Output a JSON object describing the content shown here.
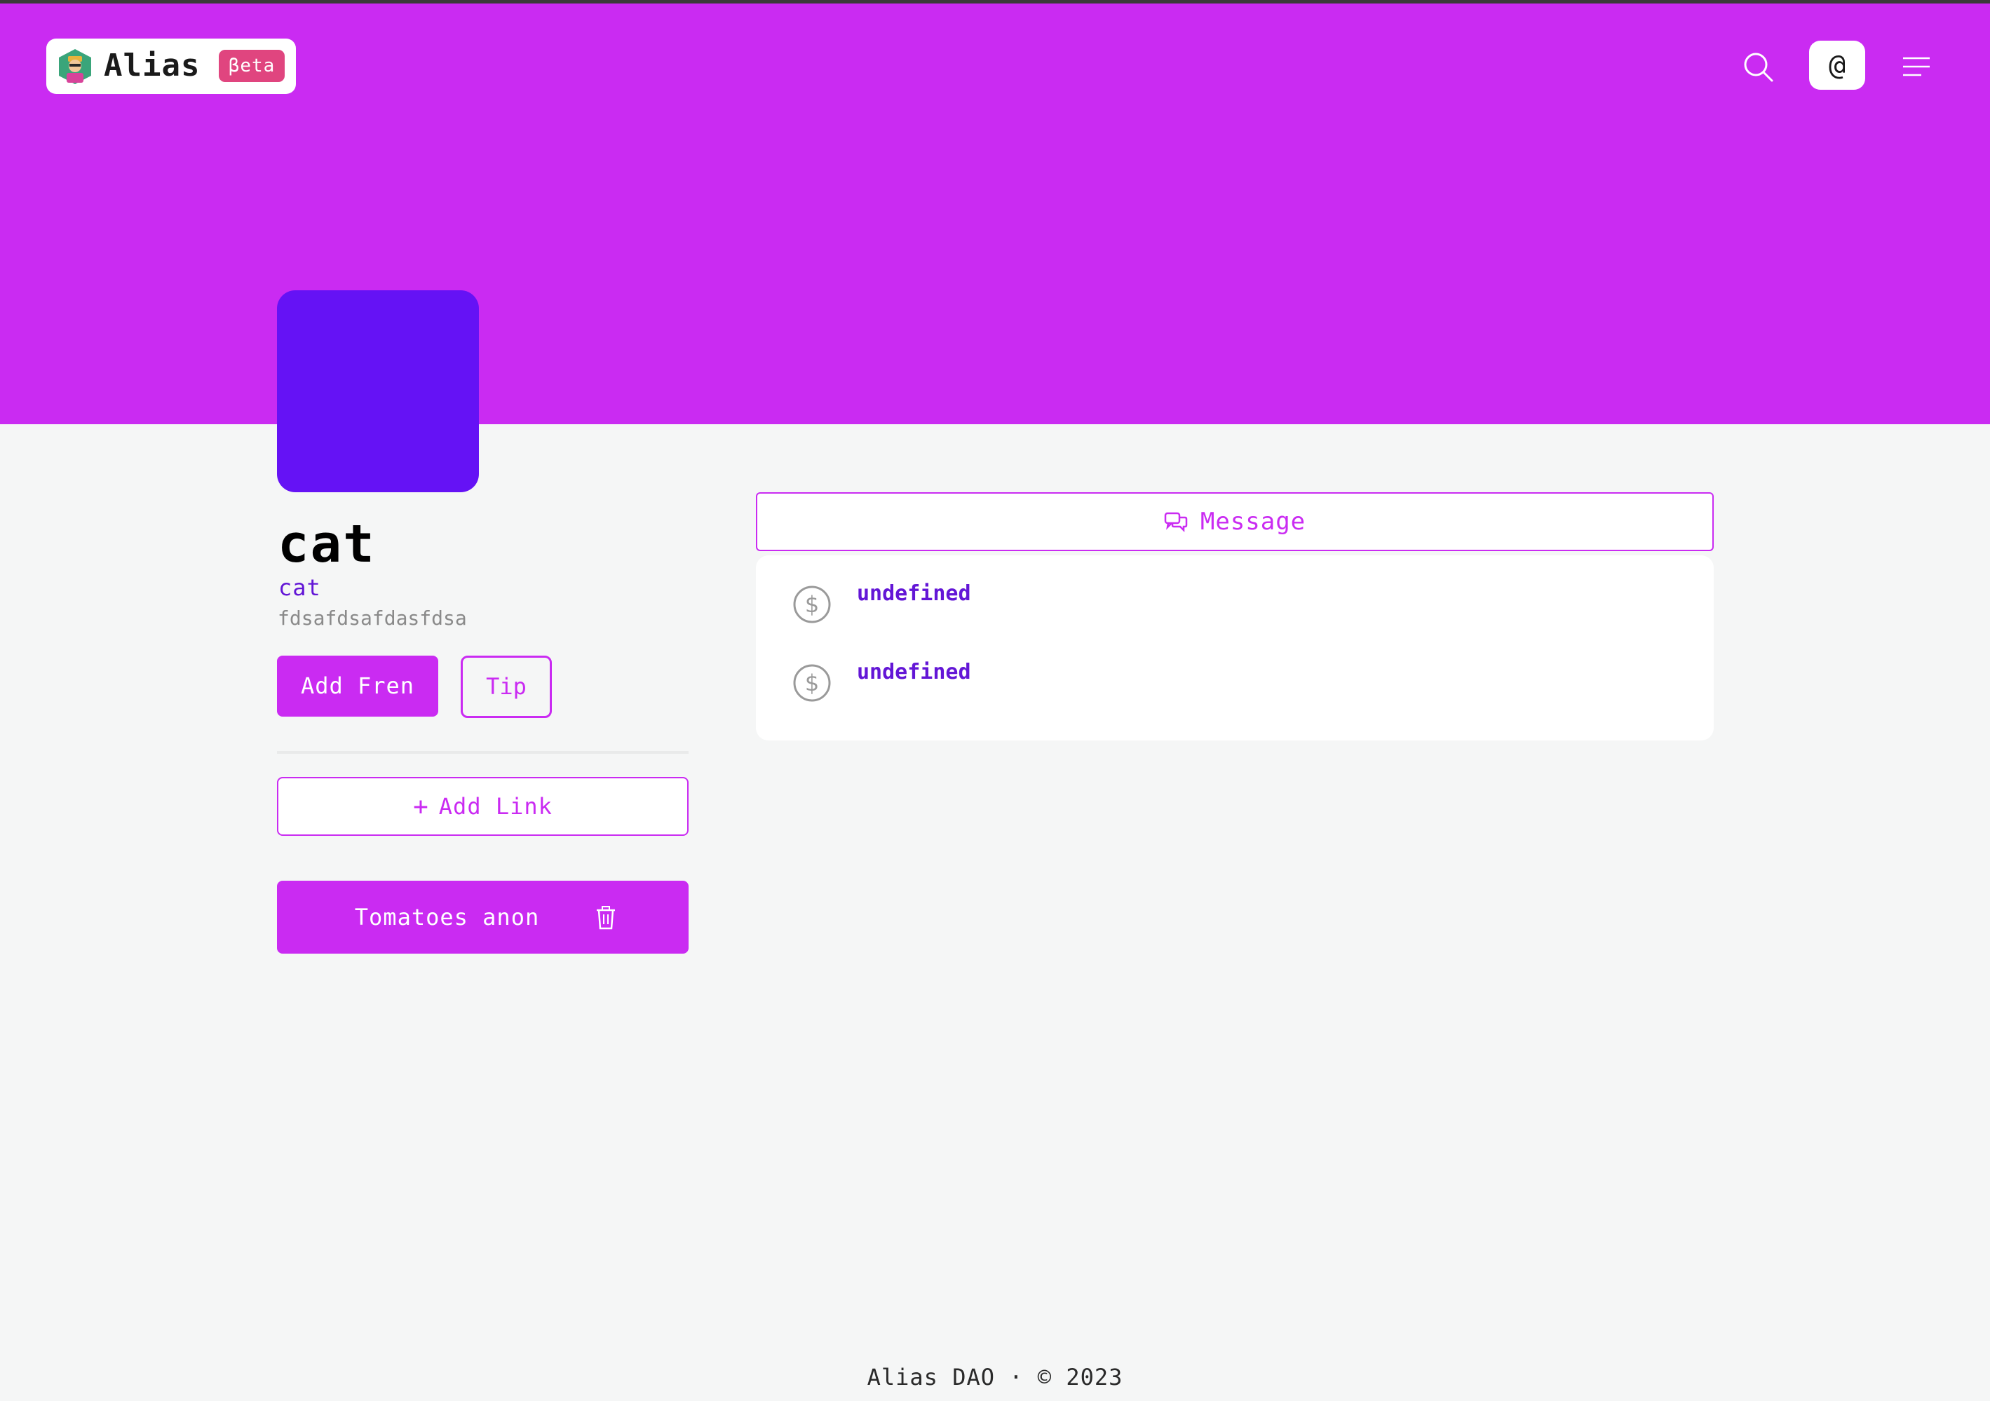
{
  "header": {
    "logo_text": "Alias",
    "beta_label": "βeta",
    "at_label": "@",
    "icons": [
      "logo-mascot-icon",
      "search-icon",
      "at-icon",
      "menu-icon"
    ]
  },
  "colors": {
    "accent": "#ca2bf2",
    "avatar": "#6512f5",
    "handle": "#6316d6",
    "beta": "#e0457f",
    "background": "#f5f6f6"
  },
  "profile": {
    "name": "cat",
    "handle": "cat",
    "bio": "fdsafdsafdasfdsa"
  },
  "actions": {
    "add_fren_label": "Add Fren",
    "tip_label": "Tip",
    "add_link_label": "Add Link",
    "add_link_icon": "+"
  },
  "links": [
    {
      "label": "Tomatoes anon",
      "icon": "trash-icon"
    }
  ],
  "message": {
    "label": "Message",
    "icon": "chat-icon"
  },
  "transactions": [
    {
      "text": "undefined",
      "icon": "dollar-coin-icon"
    },
    {
      "text": "undefined",
      "icon": "dollar-coin-icon"
    }
  ],
  "footer": {
    "text": "Alias DAO · © 2023"
  }
}
